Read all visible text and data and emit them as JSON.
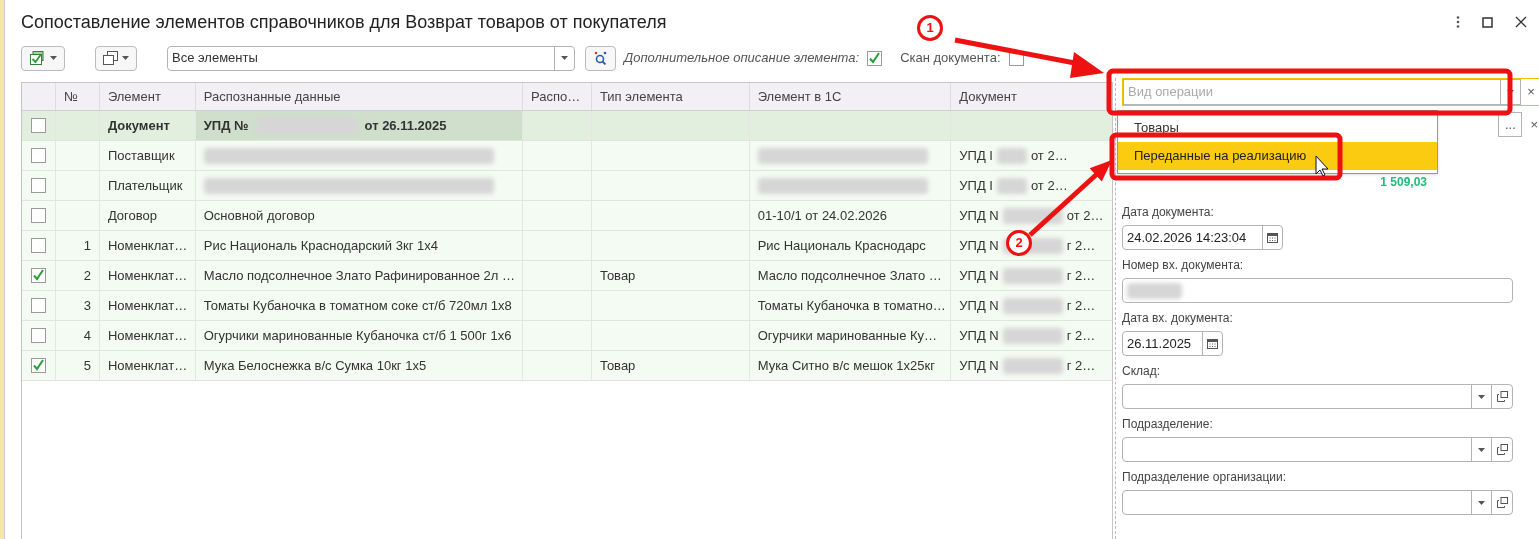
{
  "window": {
    "title": "Сопоставление элементов справочников для Возврат товаров от покупателя"
  },
  "toolbar": {
    "filter": {
      "value": "Все элементы"
    },
    "extra_description": {
      "label": "Дополнительное описание элемента:",
      "checked": true
    },
    "scan": {
      "label": "Скан документа:",
      "checked": false
    }
  },
  "table": {
    "columns": [
      "№",
      "Элемент",
      "Распознанные данные",
      "Распо…",
      "Тип элемента",
      "Элемент в 1С",
      "Документ"
    ],
    "rows": [
      {
        "checked": false,
        "kind": "header",
        "element": "Документ",
        "recognized": {
          "before": "УПД №",
          "redacted": true,
          "after": "от 26.11.2025"
        }
      },
      {
        "checked": false,
        "kind": "item",
        "element": "Поставщик",
        "recognized": {
          "redacted": true
        },
        "element_1c": {
          "redacted": true
        },
        "document": {
          "before": "УПД I",
          "after": "от 2…"
        }
      },
      {
        "checked": false,
        "kind": "item",
        "element": "Плательщик",
        "recognized": {
          "redacted": true
        },
        "element_1c": {
          "redacted": true
        },
        "document": {
          "before": "УПД I",
          "after": "от 2…"
        }
      },
      {
        "checked": false,
        "kind": "item",
        "element": "Договор",
        "recognized": {
          "before": "Основной договор"
        },
        "element_1c": {
          "text": "01-10/1 от 24.02.2026"
        },
        "document": {
          "before": "УПД N",
          "after": "от 2…"
        }
      },
      {
        "checked": false,
        "kind": "item",
        "number": "1",
        "element": "Номенклат…",
        "recognized": {
          "before": "Рис Националь Краснодарский 3кг 1х4"
        },
        "element_1c": {
          "text": "Рис Националь Краснодарс"
        },
        "document": {
          "before": "УПД N",
          "after": "г 2…"
        }
      },
      {
        "checked": true,
        "kind": "item",
        "number": "2",
        "element": "Номенклат…",
        "recognized": {
          "before": "Масло подсолнечное Злато Рафинированное 2л …"
        },
        "type": "Товар",
        "element_1c": {
          "text": "Масло подсолнечное Злато …"
        },
        "document": {
          "before": "УПД N",
          "after": "г 2…"
        }
      },
      {
        "checked": false,
        "kind": "item",
        "number": "3",
        "element": "Номенклат…",
        "recognized": {
          "before": "Томаты Кубаночка в томатном соке ст/б 720мл 1х8"
        },
        "element_1c": {
          "text": "Томаты Кубаночка в томатно…"
        },
        "document": {
          "before": "УПД N",
          "after": "г 2…"
        }
      },
      {
        "checked": false,
        "kind": "item",
        "number": "4",
        "element": "Номенклат…",
        "recognized": {
          "before": "Огурчики маринованные Кубаночка ст/б 1 500г 1х6"
        },
        "element_1c": {
          "text": "Огурчики маринованные Ку…"
        },
        "document": {
          "before": "УПД N",
          "after": "г 2…"
        }
      },
      {
        "checked": true,
        "kind": "item",
        "number": "5",
        "element": "Номенклат…",
        "recognized": {
          "before": "Мука Белоснежка в/с Сумка 10кг 1х5"
        },
        "type": "Товар",
        "element_1c": {
          "text": "Мука Ситно в/с мешок 1х25кг"
        },
        "document": {
          "before": "УПД N",
          "after": "г 2…"
        }
      }
    ]
  },
  "side_panel": {
    "operation_type": {
      "placeholder": "Вид операции",
      "clear": "×",
      "options": [
        {
          "label": "Товары",
          "selected": false
        },
        {
          "label": "Переданные на реализацию",
          "selected": true
        }
      ]
    },
    "second_field": {
      "choose": "...",
      "clear": "×"
    },
    "total": "1 509,03",
    "fields": [
      {
        "label": "Дата документа:",
        "kind": "date",
        "value": "24.02.2026 14:23:04"
      },
      {
        "label": "Номер вх. документа:",
        "kind": "text",
        "redacted": true
      },
      {
        "label": "Дата вх. документа:",
        "kind": "date",
        "value": "26.11.2025"
      },
      {
        "label": "Склад:",
        "kind": "select"
      },
      {
        "label": "Подразделение:",
        "kind": "select"
      },
      {
        "label": "Подразделение организации:",
        "kind": "select"
      }
    ]
  },
  "annotations": [
    {
      "label": "1"
    },
    {
      "label": "2"
    }
  ]
}
